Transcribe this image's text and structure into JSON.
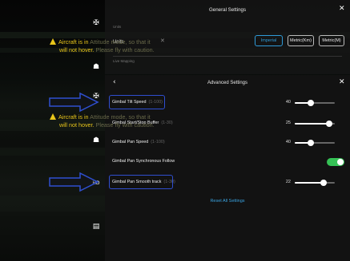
{
  "warning": {
    "line1_a": "Aircraft is in",
    "line1_b": "Attitude mode, so that it",
    "line2_a": "will not hover.",
    "line2_b": "Please fly with caution."
  },
  "general_settings": {
    "title": "General Settings",
    "section_units": "Units",
    "units_label": "Units",
    "units_options": [
      "Imperial",
      "Metric(Km)",
      "Metric(M)"
    ],
    "units_selected": "Imperial",
    "section_live_mapping": "Live Mapping"
  },
  "advanced_settings": {
    "title": "Advanced Settings",
    "rows": [
      {
        "label": "Gimbal Tilt Speed",
        "range": "(1-100)",
        "value": "40",
        "fraction": 0.4
      },
      {
        "label": "Gimbal Start/Stop Buffer",
        "range": "(1-30)",
        "value": "25",
        "fraction": 0.85
      },
      {
        "label": "Gimbal Pan Speed",
        "range": "(1-100)",
        "value": "40",
        "fraction": 0.4
      }
    ],
    "toggle_row": {
      "label": "Gimbal Pan Synchronous Follow",
      "on": true
    },
    "smooth_row": {
      "label": "Gimbal Pan Smooth track",
      "range": "(1-30)",
      "value": "22",
      "fraction": 0.72
    },
    "reset_label": "Reset All Settings"
  },
  "colors": {
    "accent": "#2f9bd8",
    "warning": "#e8c51a",
    "toggle_on": "#35c155",
    "highlight": "#2f4fd0"
  },
  "icons": [
    "drone-icon",
    "camera-icon",
    "gimbal-icon",
    "wifi-icon",
    "checklist-icon"
  ]
}
